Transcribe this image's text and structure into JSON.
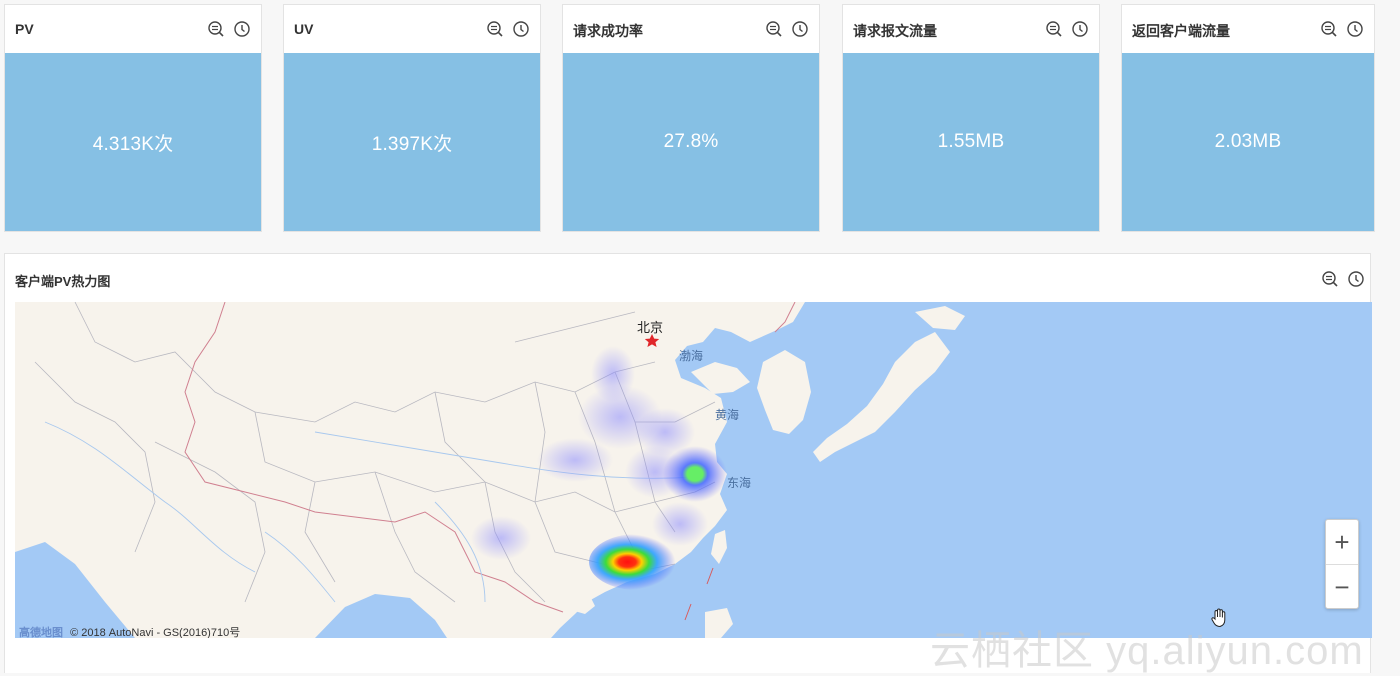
{
  "cards": [
    {
      "title": "PV",
      "value": "4.313K次"
    },
    {
      "title": "UV",
      "value": "1.397K次"
    },
    {
      "title": "请求成功率",
      "value": "27.8%"
    },
    {
      "title": "请求报文流量",
      "value": "1.55MB"
    },
    {
      "title": "返回客户端流量",
      "value": "2.03MB"
    }
  ],
  "map_panel": {
    "title": "客户端PV热力图",
    "labels": {
      "beijing": "北京",
      "bohai": "渤海",
      "huanghai": "黄海",
      "donghai": "东海"
    },
    "zoom_in": "+",
    "zoom_out": "−",
    "brand": "高德地图",
    "copyright": "© 2018 AutoNavi - GS(2016)710号"
  },
  "watermark": "云栖社区 yq.aliyun.com",
  "icons": [
    "query-icon",
    "clock-icon",
    "star-icon",
    "hand-cursor-icon"
  ],
  "colors": {
    "kpi_bg": "#86c0e4",
    "sea": "#a3c9f5",
    "land": "#f7f3ec"
  }
}
